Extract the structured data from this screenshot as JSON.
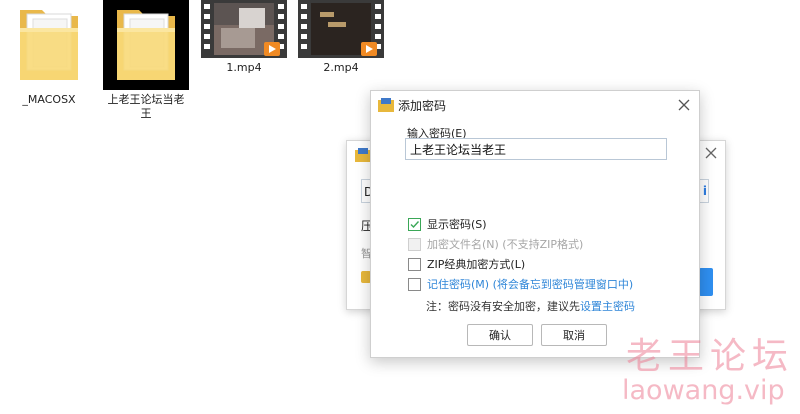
{
  "files": [
    {
      "name": "_MACOSX",
      "type": "folder"
    },
    {
      "name": "上老王论坛当老王",
      "type": "folder",
      "selected": true
    },
    {
      "name": "1.mp4",
      "type": "video"
    },
    {
      "name": "2.mp4",
      "type": "video"
    }
  ],
  "bg_dialog": {
    "path_prefix": "D",
    "link_char": "i",
    "label1": "压",
    "label2": "智"
  },
  "dialog": {
    "title": "添加密码",
    "password_label": "输入密码(E)",
    "password_value": "上老王论坛当老王",
    "options": [
      {
        "label": "显示密码(S)",
        "checked": true
      },
      {
        "label": "加密文件名(N) (不支持ZIP格式)",
        "disabled": true
      },
      {
        "label": "ZIP经典加密方式(L)",
        "checked": false
      },
      {
        "label": "记住密码(M) (将会备忘到密码管理窗口中)",
        "checked": false
      }
    ],
    "note_prefix": "注：密码没有安全加密，建议先",
    "note_link": "设置主密码",
    "ok_label": "确认",
    "cancel_label": "取消"
  },
  "watermark": {
    "line1": "老王论坛",
    "line2": "laowang.vip"
  },
  "colors": {
    "accent_blue": "#2f86d8",
    "check_green": "#3aa757",
    "folder_yellow": "#f5c94e",
    "watermark_pink": "#ec8096"
  }
}
